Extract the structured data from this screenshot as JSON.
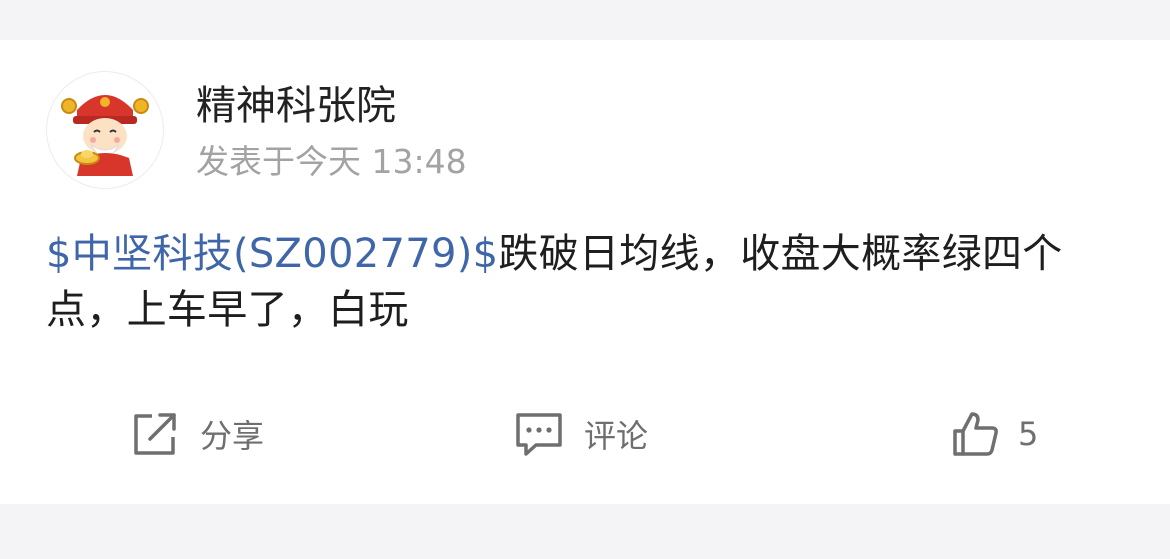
{
  "post": {
    "author": {
      "name": "精神科张院",
      "avatar_icon": "caishen-avatar-icon"
    },
    "time": "发表于今天 13:48",
    "content": {
      "stock_tag": "$中坚科技(SZ002779)$",
      "text": "跌破日均线，收盘大概率绿四个点，上车早了，白玩"
    },
    "actions": {
      "share": {
        "label": "分享",
        "icon": "share-icon"
      },
      "comment": {
        "label": "评论",
        "icon": "comment-icon"
      },
      "like": {
        "count": "5",
        "icon": "thumbs-up-icon"
      }
    }
  },
  "colors": {
    "link": "#3f66a8",
    "text": "#1e1e1e",
    "muted": "#a3a3a3",
    "background": "#f4f4f6"
  }
}
